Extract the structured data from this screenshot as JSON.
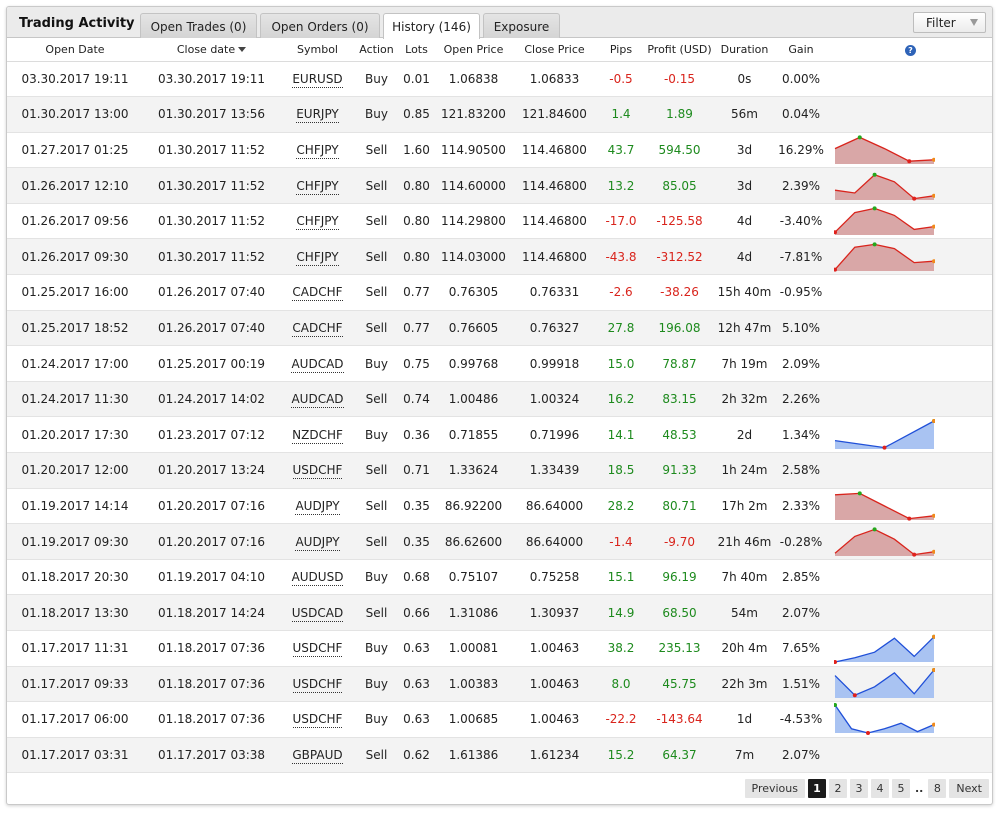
{
  "app_title": "Trading Activity",
  "tabs": [
    {
      "label": "Open Trades (0)"
    },
    {
      "label": "Open Orders (0)"
    },
    {
      "label": "History (146)"
    },
    {
      "label": "Exposure"
    }
  ],
  "filter_label": "Filter",
  "columns": {
    "open_date": "Open Date",
    "close_date": "Close date",
    "symbol": "Symbol",
    "action": "Action",
    "lots": "Lots",
    "open_price": "Open Price",
    "close_price": "Close Price",
    "pips": "Pips",
    "profit": "Profit (USD)",
    "duration": "Duration",
    "gain": "Gain",
    "help_glyph": "?"
  },
  "colors": {
    "positive": "#1d8a1d",
    "negative": "#d9241c",
    "spark_red_fill": "#d9a7a7",
    "spark_blue_fill": "#a9c3f2",
    "active_tab": "#ffffff"
  },
  "rows": [
    {
      "open": "03.30.2017 19:11",
      "close": "03.30.2017 19:11",
      "symbol": "EURUSD",
      "action": "Buy",
      "lots": "0.01",
      "open_price": "1.06838",
      "close_price": "1.06833",
      "pips": "-0.5",
      "profit": "-0.15",
      "duration": "0s",
      "gain": "0.00%",
      "sign": "neg",
      "spark": null
    },
    {
      "open": "01.30.2017 13:00",
      "close": "01.30.2017 13:56",
      "symbol": "EURJPY",
      "action": "Buy",
      "lots": "0.85",
      "open_price": "121.83200",
      "close_price": "121.84600",
      "pips": "1.4",
      "profit": "1.89",
      "duration": "56m",
      "gain": "0.04%",
      "sign": "pos",
      "spark": null
    },
    {
      "open": "01.27.2017 01:25",
      "close": "01.30.2017 11:52",
      "symbol": "CHFJPY",
      "action": "Sell",
      "lots": "1.60",
      "open_price": "114.90500",
      "close_price": "114.46800",
      "pips": "43.7",
      "profit": "594.50",
      "duration": "3d",
      "gain": "16.29%",
      "sign": "pos",
      "spark": {
        "color": "red",
        "values": [
          0.55,
          0.95,
          0.55,
          0.1,
          0.15
        ]
      }
    },
    {
      "open": "01.26.2017 12:10",
      "close": "01.30.2017 11:52",
      "symbol": "CHFJPY",
      "action": "Sell",
      "lots": "0.80",
      "open_price": "114.60000",
      "close_price": "114.46800",
      "pips": "13.2",
      "profit": "85.05",
      "duration": "3d",
      "gain": "2.39%",
      "sign": "pos",
      "spark": {
        "color": "red",
        "values": [
          0.35,
          0.25,
          0.9,
          0.65,
          0.05,
          0.15
        ]
      }
    },
    {
      "open": "01.26.2017 09:56",
      "close": "01.30.2017 11:52",
      "symbol": "CHFJPY",
      "action": "Sell",
      "lots": "0.80",
      "open_price": "114.29800",
      "close_price": "114.46800",
      "pips": "-17.0",
      "profit": "-125.58",
      "duration": "4d",
      "gain": "-3.40%",
      "sign": "neg",
      "spark": {
        "color": "red",
        "values": [
          0.1,
          0.8,
          0.95,
          0.7,
          0.2,
          0.3
        ]
      }
    },
    {
      "open": "01.26.2017 09:30",
      "close": "01.30.2017 11:52",
      "symbol": "CHFJPY",
      "action": "Sell",
      "lots": "0.80",
      "open_price": "114.03000",
      "close_price": "114.46800",
      "pips": "-43.8",
      "profit": "-312.52",
      "duration": "4d",
      "gain": "-7.81%",
      "sign": "neg",
      "spark": {
        "color": "red",
        "values": [
          0.05,
          0.85,
          0.95,
          0.8,
          0.3,
          0.35
        ]
      }
    },
    {
      "open": "01.25.2017 16:00",
      "close": "01.26.2017 07:40",
      "symbol": "CADCHF",
      "action": "Sell",
      "lots": "0.77",
      "open_price": "0.76305",
      "close_price": "0.76331",
      "pips": "-2.6",
      "profit": "-38.26",
      "duration": "15h 40m",
      "gain": "-0.95%",
      "sign": "neg",
      "spark": null
    },
    {
      "open": "01.25.2017 18:52",
      "close": "01.26.2017 07:40",
      "symbol": "CADCHF",
      "action": "Sell",
      "lots": "0.77",
      "open_price": "0.76605",
      "close_price": "0.76327",
      "pips": "27.8",
      "profit": "196.08",
      "duration": "12h 47m",
      "gain": "5.10%",
      "sign": "pos",
      "spark": null
    },
    {
      "open": "01.24.2017 17:00",
      "close": "01.25.2017 00:19",
      "symbol": "AUDCAD",
      "action": "Buy",
      "lots": "0.75",
      "open_price": "0.99768",
      "close_price": "0.99918",
      "pips": "15.0",
      "profit": "78.87",
      "duration": "7h 19m",
      "gain": "2.09%",
      "sign": "pos",
      "spark": null
    },
    {
      "open": "01.24.2017 11:30",
      "close": "01.24.2017 14:02",
      "symbol": "AUDCAD",
      "action": "Sell",
      "lots": "0.74",
      "open_price": "1.00486",
      "close_price": "1.00324",
      "pips": "16.2",
      "profit": "83.15",
      "duration": "2h 32m",
      "gain": "2.26%",
      "sign": "pos",
      "spark": null
    },
    {
      "open": "01.20.2017 17:30",
      "close": "01.23.2017 07:12",
      "symbol": "NZDCHF",
      "action": "Buy",
      "lots": "0.36",
      "open_price": "0.71855",
      "close_price": "0.71996",
      "pips": "14.1",
      "profit": "48.53",
      "duration": "2d",
      "gain": "1.34%",
      "sign": "pos",
      "spark": {
        "color": "blue",
        "values": [
          0.3,
          0.05,
          1.0
        ]
      }
    },
    {
      "open": "01.20.2017 12:00",
      "close": "01.20.2017 13:24",
      "symbol": "USDCHF",
      "action": "Sell",
      "lots": "0.71",
      "open_price": "1.33624",
      "close_price": "1.33439",
      "pips": "18.5",
      "profit": "91.33",
      "duration": "1h 24m",
      "gain": "2.58%",
      "sign": "pos",
      "spark": null
    },
    {
      "open": "01.19.2017 14:14",
      "close": "01.20.2017 07:16",
      "symbol": "AUDJPY",
      "action": "Sell",
      "lots": "0.35",
      "open_price": "86.92200",
      "close_price": "86.64000",
      "pips": "28.2",
      "profit": "80.71",
      "duration": "17h 2m",
      "gain": "2.33%",
      "sign": "pos",
      "spark": {
        "color": "red",
        "values": [
          0.9,
          0.95,
          0.5,
          0.05,
          0.15
        ]
      }
    },
    {
      "open": "01.19.2017 09:30",
      "close": "01.20.2017 07:16",
      "symbol": "AUDJPY",
      "action": "Sell",
      "lots": "0.35",
      "open_price": "86.62600",
      "close_price": "86.64000",
      "pips": "-1.4",
      "profit": "-9.70",
      "duration": "21h 46m",
      "gain": "-0.28%",
      "sign": "neg",
      "spark": {
        "color": "red",
        "values": [
          0.1,
          0.7,
          0.95,
          0.6,
          0.05,
          0.15
        ]
      }
    },
    {
      "open": "01.18.2017 20:30",
      "close": "01.19.2017 04:10",
      "symbol": "AUDUSD",
      "action": "Buy",
      "lots": "0.68",
      "open_price": "0.75107",
      "close_price": "0.75258",
      "pips": "15.1",
      "profit": "96.19",
      "duration": "7h 40m",
      "gain": "2.85%",
      "sign": "pos",
      "spark": null
    },
    {
      "open": "01.18.2017 13:30",
      "close": "01.18.2017 14:24",
      "symbol": "USDCAD",
      "action": "Sell",
      "lots": "0.66",
      "open_price": "1.31086",
      "close_price": "1.30937",
      "pips": "14.9",
      "profit": "68.50",
      "duration": "54m",
      "gain": "2.07%",
      "sign": "pos",
      "spark": null
    },
    {
      "open": "01.17.2017 11:31",
      "close": "01.18.2017 07:36",
      "symbol": "USDCHF",
      "action": "Buy",
      "lots": "0.63",
      "open_price": "1.00081",
      "close_price": "1.00463",
      "pips": "38.2",
      "profit": "235.13",
      "duration": "20h 4m",
      "gain": "7.65%",
      "sign": "pos",
      "spark": {
        "color": "blue",
        "values": [
          0.0,
          0.15,
          0.35,
          0.85,
          0.2,
          0.9
        ]
      }
    },
    {
      "open": "01.17.2017 09:33",
      "close": "01.18.2017 07:36",
      "symbol": "USDCHF",
      "action": "Buy",
      "lots": "0.63",
      "open_price": "1.00383",
      "close_price": "1.00463",
      "pips": "8.0",
      "profit": "45.75",
      "duration": "22h 3m",
      "gain": "1.51%",
      "sign": "pos",
      "spark": {
        "color": "blue",
        "values": [
          0.8,
          0.1,
          0.4,
          0.9,
          0.15,
          1.0
        ]
      }
    },
    {
      "open": "01.17.2017 06:00",
      "close": "01.18.2017 07:36",
      "symbol": "USDCHF",
      "action": "Buy",
      "lots": "0.63",
      "open_price": "1.00685",
      "close_price": "1.00463",
      "pips": "-22.2",
      "profit": "-143.64",
      "duration": "1d",
      "gain": "-4.53%",
      "sign": "neg",
      "spark": {
        "color": "blue",
        "values": [
          1.0,
          0.15,
          0.0,
          0.15,
          0.35,
          0.05,
          0.3
        ]
      }
    },
    {
      "open": "01.17.2017 03:31",
      "close": "01.17.2017 03:38",
      "symbol": "GBPAUD",
      "action": "Sell",
      "lots": "0.62",
      "open_price": "1.61386",
      "close_price": "1.61234",
      "pips": "15.2",
      "profit": "64.37",
      "duration": "7m",
      "gain": "2.07%",
      "sign": "pos",
      "spark": null
    }
  ],
  "pagination": {
    "previous": "Previous",
    "pages": [
      "1",
      "2",
      "3",
      "4",
      "5"
    ],
    "ellipsis": "..",
    "last": "8",
    "next": "Next",
    "current": "1"
  }
}
